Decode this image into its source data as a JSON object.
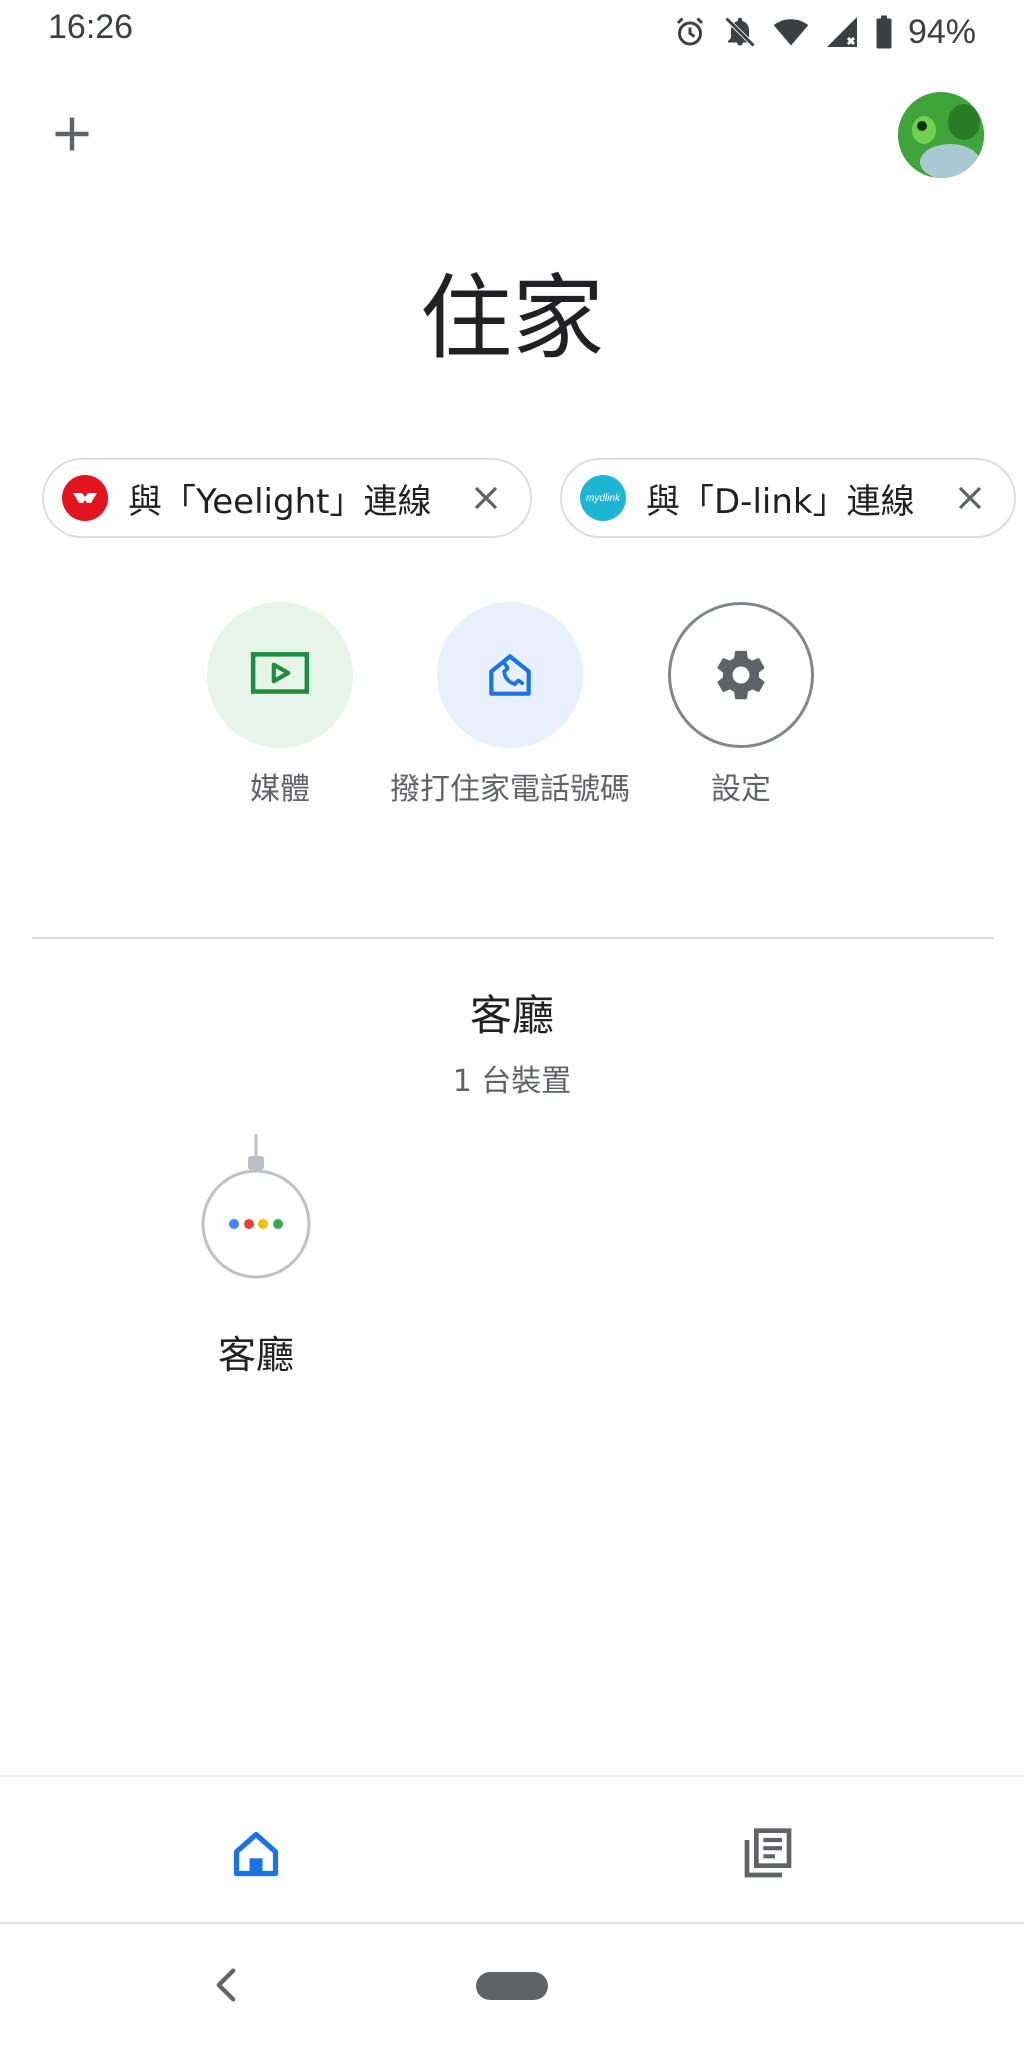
{
  "status_bar": {
    "time": "16:26",
    "battery": "94%",
    "icons": [
      "alarm-icon",
      "notifications-off-icon",
      "wifi-icon",
      "cell-signal-icon",
      "battery-icon"
    ]
  },
  "top_bar": {
    "add_icon": "plus-icon",
    "avatar": "profile-avatar"
  },
  "title": "住家",
  "chips": [
    {
      "label": "與「Yeelight」連線",
      "logo_color": "#e3141d",
      "close_icon": "close-icon"
    },
    {
      "label": "與「D-link」連線",
      "logo_color": "#1fb6d4",
      "logo_text": "mydlink",
      "close_icon": "close-icon"
    }
  ],
  "actions": [
    {
      "label": "媒體",
      "icon": "media-icon",
      "bg": "#e6f4ea",
      "color": "#1e8e3e"
    },
    {
      "label": "撥打住家電話號碼",
      "icon": "home-phone-icon",
      "bg": "#e8f0fe",
      "color": "#1a73e8"
    },
    {
      "label": "設定",
      "icon": "gear-icon",
      "bg": "#ffffff",
      "color": "#5f6368"
    }
  ],
  "room": {
    "name": "客廳",
    "device_count": "1 台裝置",
    "devices": [
      {
        "label": "客廳",
        "icon": "smart-speaker-icon"
      }
    ]
  },
  "bottom_nav": {
    "home_icon": "home-icon",
    "feed_icon": "feed-icon",
    "active": "home"
  },
  "colors": {
    "accent": "#1a73e8",
    "google_dots": [
      "#4285f4",
      "#ea4335",
      "#fbbc04",
      "#34a853"
    ]
  }
}
